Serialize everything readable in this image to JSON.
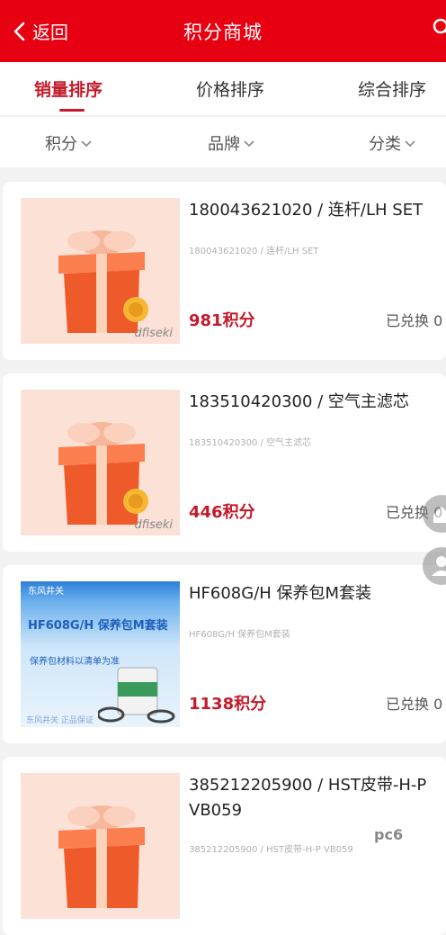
{
  "header": {
    "back_label": "返回",
    "title": "积分商城"
  },
  "tabs": [
    {
      "label": "销量排序",
      "active": true
    },
    {
      "label": "价格排序",
      "active": false
    },
    {
      "label": "综合排序",
      "active": false
    }
  ],
  "filters": [
    {
      "label": "积分"
    },
    {
      "label": "品牌"
    },
    {
      "label": "分类"
    }
  ],
  "products": [
    {
      "title": "180043621020 / 连杆/LH SET",
      "subtitle": "180043621020 / 连杆/LH SET",
      "points": "981积分",
      "exchanged": "已兑换 0",
      "watermark": "dfiseki",
      "image": "gift-box"
    },
    {
      "title": "183510420300 / 空气主滤芯",
      "subtitle": "183510420300 / 空气主滤芯",
      "points": "446积分",
      "exchanged": "已兑换 0",
      "watermark": "dfiseki",
      "image": "gift-box"
    },
    {
      "title": "HF608G/H 保养包M套装",
      "subtitle": "HF608G/H 保养包M套装",
      "points": "1138积分",
      "exchanged": "已兑换 0",
      "image": "maintenance-kit",
      "image_text": {
        "brand": "东风井关",
        "headline": "HF608G/H 保养包M套装",
        "note": "保养包材料以清单为准",
        "footer": "东风井关 正品保证"
      }
    },
    {
      "title": "385212205900 / HST皮带-H-P VB059",
      "subtitle": "385212205900 / HST皮带-H-P VB059",
      "points": "",
      "exchanged": "",
      "image": "gift-box"
    }
  ],
  "watermark_site": "pc6",
  "colors": {
    "brand_red": "#e60012",
    "price_red": "#c41a2a"
  }
}
